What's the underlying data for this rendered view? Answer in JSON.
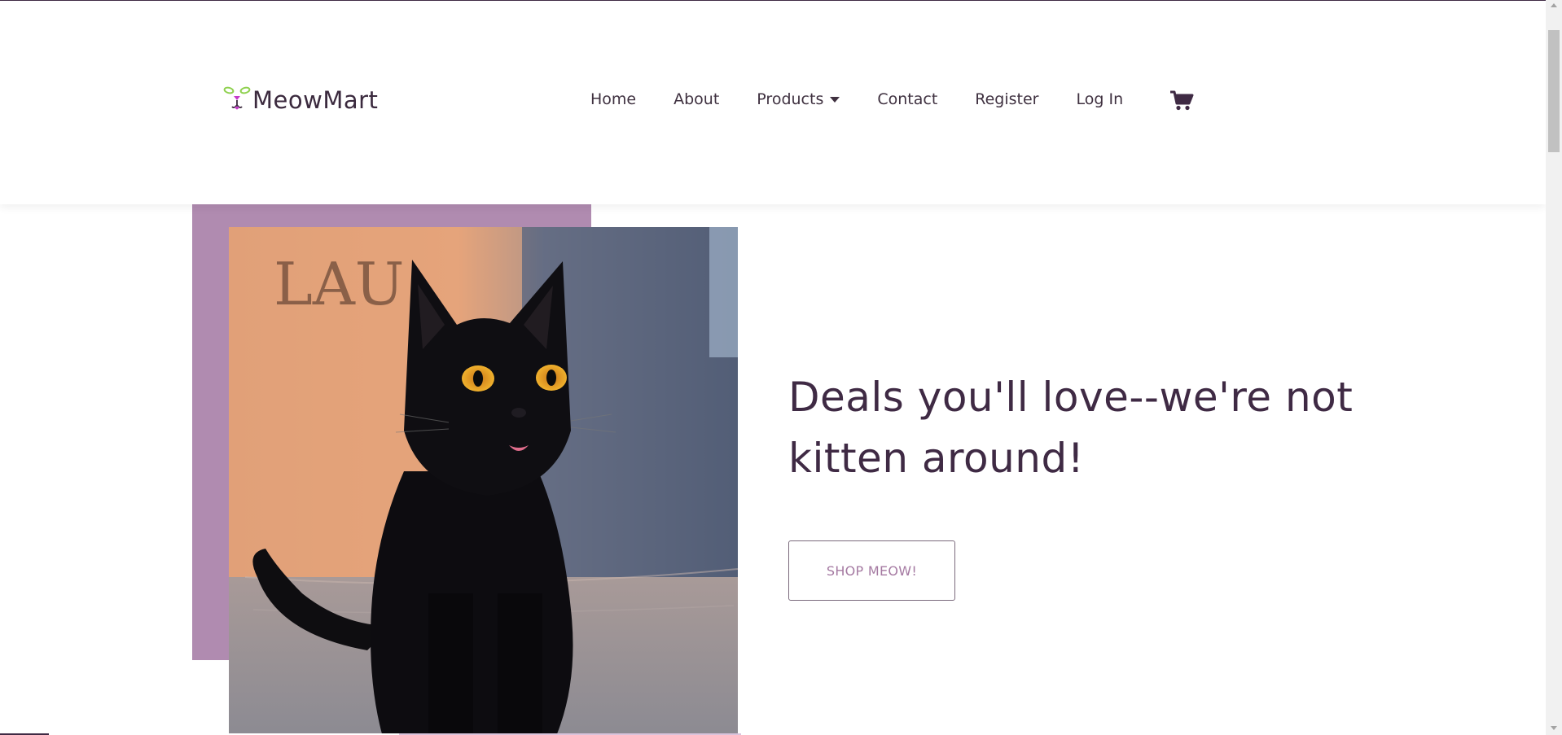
{
  "brand": {
    "name": "MeowMart",
    "logo_icon": "cat-face-logo-icon"
  },
  "nav": {
    "items": [
      {
        "label": "Home"
      },
      {
        "label": "About"
      },
      {
        "label": "Products",
        "dropdown": true
      },
      {
        "label": "Contact"
      },
      {
        "label": "Register"
      },
      {
        "label": "Log In"
      }
    ],
    "cart_icon": "shopping-cart-icon"
  },
  "hero": {
    "headline": "Deals you'll love--we're not kitten around!",
    "cta_label": "SHOP MEOW!",
    "image_subject": "black cat sitting on wooden floor"
  },
  "colors": {
    "accent_purple": "#b08bb0",
    "text_dark": "#3f2a44",
    "button_text": "#a57aa2"
  }
}
